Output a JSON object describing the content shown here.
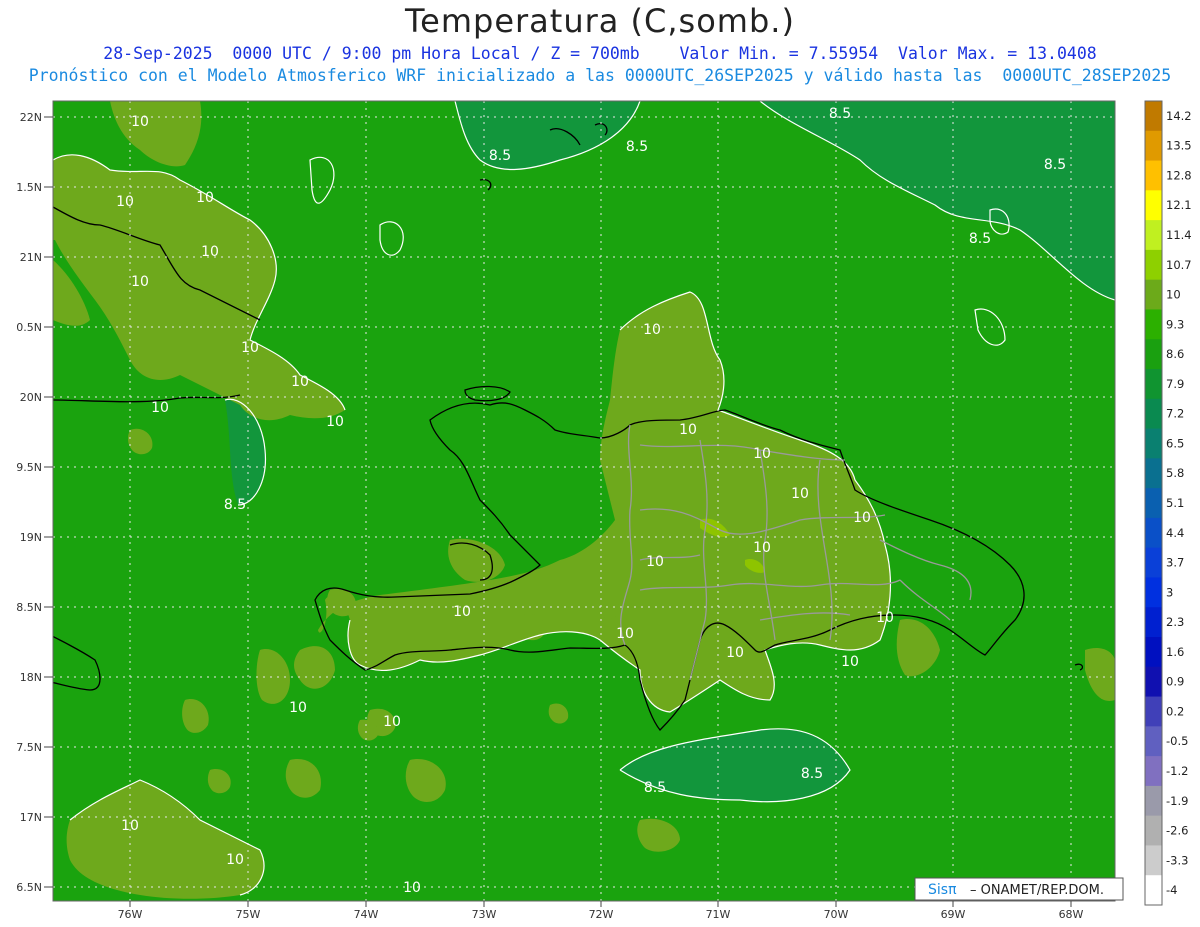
{
  "header": {
    "title": "Temperatura (C,somb.)",
    "line1": "28-Sep-2025  0000 UTC / 9:00 pm Hora Local / Z = 700mb    Valor Min. = 7.55954  Valor Max. = 13.0408",
    "line2": "Pronóstico con el Modelo Atmosferico WRF inicializado a las 0000UTC_26SEP2025 y válido hasta las  0000UTC_28SEP2025"
  },
  "axes": {
    "lat_labels": [
      "22N",
      "1.5N",
      "21N",
      "0.5N",
      "20N",
      "9.5N",
      "19N",
      "8.5N",
      "18N",
      "7.5N",
      "17N",
      "6.5N"
    ],
    "lon_labels": [
      "76W",
      "75W",
      "74W",
      "73W",
      "72W",
      "71W",
      "70W",
      "69W",
      "68W"
    ]
  },
  "contour_labels": [
    "10",
    "8.5"
  ],
  "colorbar": {
    "labels": [
      "14.2",
      "13.5",
      "12.8",
      "12.1",
      "11.4",
      "10.7",
      "10",
      "9.3",
      "8.6",
      "7.9",
      "7.2",
      "6.5",
      "5.8",
      "5.1",
      "4.4",
      "3.7",
      "3",
      "2.3",
      "1.6",
      "0.9",
      "0.2",
      "-0.5",
      "-1.2",
      "-1.9",
      "-2.6",
      "-3.3",
      "-4"
    ],
    "colors": [
      "#c07a00",
      "#e09a00",
      "#ffc000",
      "#ffff00",
      "#c0f020",
      "#8ed000",
      "#6caa1a",
      "#2cb000",
      "#1aa010",
      "#109430",
      "#0a8a50",
      "#0a8070",
      "#0a7090",
      "#0a60b0",
      "#0a50c8",
      "#0a40d8",
      "#0030e0",
      "#0020d0",
      "#0010c0",
      "#1010b0",
      "#4040b8",
      "#6060c0",
      "#8070c0",
      "#9a9aaa",
      "#b0b0b0",
      "#cccccc",
      "#ffffff"
    ]
  },
  "credit": {
    "brand": "Sisπ",
    "text": "– ONAMET/REP.DOM."
  },
  "colors": {
    "sea": "#1aa30e",
    "warm": "#6ea91c",
    "warmer": "#8ec400",
    "cool": "#12963c",
    "grid": "#e8e8e8"
  }
}
